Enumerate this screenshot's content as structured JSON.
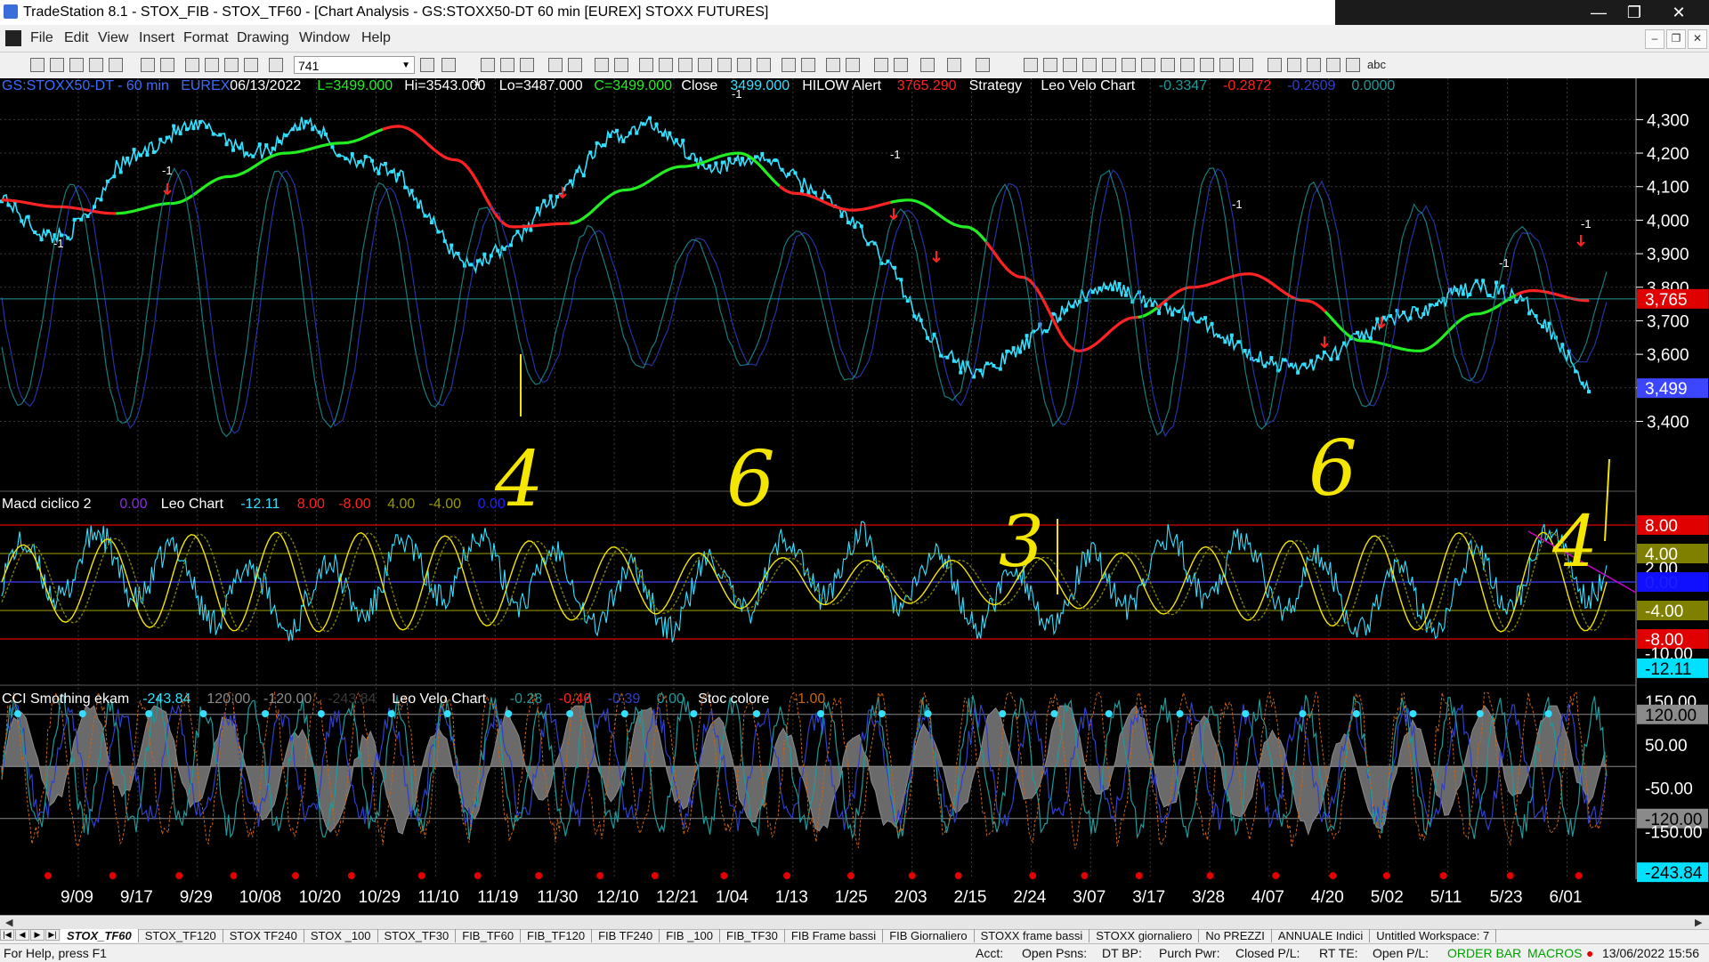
{
  "window": {
    "title": "TradeStation 8.1 - STOX_FIB - STOX_TF60 - [Chart Analysis - GS:STOXX50-DT  60 min  [EUREX] STOXX FUTURES]",
    "minimize": "—",
    "maximize": "❐",
    "close": "✕"
  },
  "menu": {
    "items": [
      "File",
      "Edit",
      "View",
      "Insert",
      "Format",
      "Drawing",
      "Window",
      "Help"
    ],
    "mdi_min": "–",
    "mdi_restore": "❐",
    "mdi_close": "✕"
  },
  "toolbar": {
    "interval_value": "741",
    "text_tool": "abc"
  },
  "colors": {
    "background": "#000000",
    "price": "#33e0ff",
    "ma_up": "#22ee22",
    "ma_down": "#ff2222",
    "osc_blue": "#3040c8",
    "osc_teal": "#1e9a9a",
    "annotation": "#f5e600",
    "histogram": "#6a6a6a"
  },
  "price_panel": {
    "legend": [
      {
        "text": "GS:STOXX50-DT - 60 min",
        "color": "#3c6cff"
      },
      {
        "text": "EUREX",
        "color": "#3c6cff"
      },
      {
        "text": "06/13/2022",
        "color": "#ffffff"
      },
      {
        "text": "L=3499.000",
        "color": "#22ee22"
      },
      {
        "text": "Hi=3543.000",
        "color": "#ffffff"
      },
      {
        "text": "Lo=3487.000",
        "color": "#ffffff"
      },
      {
        "text": "C=3499.000",
        "color": "#22ee22"
      },
      {
        "text": "Close",
        "color": "#ffffff"
      },
      {
        "text": "3499.000",
        "color": "#33e0ff"
      },
      {
        "text": "HILOW Alert",
        "color": "#ffffff"
      },
      {
        "text": "3765.290",
        "color": "#ff2222"
      },
      {
        "text": "Strategy",
        "color": "#ffffff"
      },
      {
        "text": "Leo Velo Chart",
        "color": "#ffffff"
      },
      {
        "text": "-0.3347",
        "color": "#1e9a9a"
      },
      {
        "text": "-0.2872",
        "color": "#ff2222"
      },
      {
        "text": "-0.2609",
        "color": "#3040c8"
      },
      {
        "text": "0.0000",
        "color": "#1e9a9a"
      }
    ],
    "axis_ticks": [
      "4,300",
      "4,200",
      "4,100",
      "4,000",
      "3,900",
      "3,800",
      "3,700",
      "3,600",
      "3,500",
      "3,400"
    ],
    "tag_hilow": "3,765",
    "tag_close": "3,499",
    "ma_path_label": "-1",
    "annotations": [
      "4",
      "6",
      "3",
      "6",
      "4"
    ]
  },
  "macd_panel": {
    "legend": [
      {
        "text": "Macd ciclico 2",
        "color": "#ffffff"
      },
      {
        "text": "0.00",
        "color": "#8a2be2"
      },
      {
        "text": "Leo Chart",
        "color": "#ffffff"
      },
      {
        "text": "-12.11",
        "color": "#33e0ff"
      },
      {
        "text": "8.00",
        "color": "#ff2222"
      },
      {
        "text": "-8.00",
        "color": "#ff2222"
      },
      {
        "text": "4.00",
        "color": "#9a9a00"
      },
      {
        "text": "-4.00",
        "color": "#9a9a00"
      },
      {
        "text": "0.00",
        "color": "#2020ff"
      }
    ],
    "tags": [
      {
        "text": "8.00",
        "bg": "#e00000",
        "fg": "#ffffff"
      },
      {
        "text": "4.00",
        "bg": "#808000",
        "fg": "#ffffff"
      },
      {
        "text": "2.00",
        "bg": "none",
        "fg": "#ffffff"
      },
      {
        "text": "0.00",
        "bg": "#1010ff",
        "fg": "#2020ff"
      },
      {
        "text": "-4.00",
        "bg": "#808000",
        "fg": "#ffffff"
      },
      {
        "text": "-8.00",
        "bg": "#e00000",
        "fg": "#ffffff"
      },
      {
        "text": "-10.00",
        "bg": "none",
        "fg": "#ffffff"
      },
      {
        "text": "-12.11",
        "bg": "#00e0ff",
        "fg": "#000000"
      }
    ]
  },
  "cci_panel": {
    "legend": [
      {
        "text": "CCI Smothing ekam",
        "color": "#ffffff"
      },
      {
        "text": "-243.84",
        "color": "#33e0ff"
      },
      {
        "text": "120.00",
        "color": "#8a8a8a"
      },
      {
        "text": "-120.00",
        "color": "#8a8a8a"
      },
      {
        "text": "-243.84",
        "color": "#3a3a3a"
      },
      {
        "text": "Leo Velo Chart",
        "color": "#ffffff"
      },
      {
        "text": "-0.28",
        "color": "#1e9a9a"
      },
      {
        "text": "-0.46",
        "color": "#ff2222"
      },
      {
        "text": "-0.39",
        "color": "#3040c8"
      },
      {
        "text": "0.00",
        "color": "#1e9a9a"
      },
      {
        "text": "Stoc colore",
        "color": "#ffffff"
      },
      {
        "text": "-1.00",
        "color": "#c86414"
      }
    ],
    "tags": [
      {
        "text": "150.00",
        "bg": "none",
        "fg": "#ffffff"
      },
      {
        "text": "120.00",
        "bg": "#8a8a8a",
        "fg": "#000000"
      },
      {
        "text": "50.00",
        "bg": "none",
        "fg": "#ffffff"
      },
      {
        "text": "-50.00",
        "bg": "none",
        "fg": "#ffffff"
      },
      {
        "text": "-120.00",
        "bg": "#8a8a8a",
        "fg": "#000000"
      },
      {
        "text": "-150.00",
        "bg": "none",
        "fg": "#ffffff"
      },
      {
        "text": "-243.84",
        "bg": "#00e0ff",
        "fg": "#000000"
      }
    ]
  },
  "chart_data": {
    "type": "line",
    "x_labels": [
      "9/09",
      "9/17",
      "9/29",
      "10/08",
      "10/20",
      "10/29",
      "11/10",
      "11/19",
      "11/30",
      "12/10",
      "12/21",
      "1/04",
      "1/13",
      "1/25",
      "2/03",
      "2/15",
      "2/24",
      "3/07",
      "3/17",
      "3/28",
      "4/07",
      "4/20",
      "5/02",
      "5/11",
      "5/23",
      "6/01"
    ],
    "price": {
      "ylim": [
        3250,
        4370
      ],
      "close_points": [
        [
          0,
          4080
        ],
        [
          1,
          4000
        ],
        [
          2,
          3950
        ],
        [
          3,
          3960
        ],
        [
          4,
          4030
        ],
        [
          5,
          4150
        ],
        [
          6,
          4190
        ],
        [
          7,
          4230
        ],
        [
          8,
          4270
        ],
        [
          9,
          4280
        ],
        [
          10,
          4250
        ],
        [
          11,
          4200
        ],
        [
          12,
          4210
        ],
        [
          13,
          4280
        ],
        [
          14,
          4290
        ],
        [
          15,
          4200
        ],
        [
          16,
          4180
        ],
        [
          17,
          4150
        ],
        [
          18,
          4120
        ],
        [
          19,
          4020
        ],
        [
          20,
          3920
        ],
        [
          21,
          3860
        ],
        [
          22,
          3900
        ],
        [
          23,
          3940
        ],
        [
          24,
          4020
        ],
        [
          25,
          4080
        ],
        [
          26,
          4150
        ],
        [
          27,
          4240
        ],
        [
          28,
          4260
        ],
        [
          29,
          4290
        ],
        [
          30,
          4250
        ],
        [
          31,
          4180
        ],
        [
          32,
          4160
        ],
        [
          33,
          4170
        ],
        [
          34,
          4190
        ],
        [
          35,
          4150
        ],
        [
          36,
          4100
        ],
        [
          37,
          4060
        ],
        [
          38,
          4000
        ],
        [
          39,
          3920
        ],
        [
          40,
          3840
        ],
        [
          41,
          3700
        ],
        [
          42,
          3620
        ],
        [
          43,
          3560
        ],
        [
          44,
          3550
        ],
        [
          45,
          3590
        ],
        [
          46,
          3640
        ],
        [
          47,
          3700
        ],
        [
          48,
          3760
        ],
        [
          49,
          3790
        ],
        [
          50,
          3800
        ],
        [
          51,
          3760
        ],
        [
          52,
          3740
        ],
        [
          53,
          3720
        ],
        [
          54,
          3680
        ],
        [
          55,
          3640
        ],
        [
          56,
          3600
        ],
        [
          57,
          3570
        ],
        [
          58,
          3560
        ],
        [
          59,
          3580
        ],
        [
          60,
          3620
        ],
        [
          61,
          3660
        ],
        [
          62,
          3700
        ],
        [
          63,
          3720
        ],
        [
          64,
          3740
        ],
        [
          65,
          3780
        ],
        [
          66,
          3800
        ],
        [
          67,
          3790
        ],
        [
          68,
          3760
        ],
        [
          69,
          3700
        ],
        [
          70,
          3600
        ],
        [
          71,
          3499
        ]
      ],
      "ma_points": [
        [
          0,
          4060
        ],
        [
          3,
          4040
        ],
        [
          6,
          4020
        ],
        [
          9,
          4050
        ],
        [
          12,
          4130
        ],
        [
          15,
          4200
        ],
        [
          18,
          4230
        ],
        [
          21,
          4280
        ],
        [
          24,
          4180
        ],
        [
          27,
          3980
        ],
        [
          30,
          3990
        ],
        [
          33,
          4090
        ],
        [
          36,
          4160
        ],
        [
          39,
          4200
        ],
        [
          42,
          4080
        ],
        [
          45,
          4030
        ],
        [
          48,
          4060
        ],
        [
          51,
          3980
        ],
        [
          54,
          3830
        ],
        [
          57,
          3610
        ],
        [
          60,
          3710
        ],
        [
          63,
          3800
        ],
        [
          66,
          3840
        ],
        [
          69,
          3760
        ],
        [
          72,
          3640
        ],
        [
          75,
          3610
        ],
        [
          78,
          3720
        ],
        [
          81,
          3790
        ],
        [
          84,
          3760
        ]
      ],
      "ma_down_segments": [
        [
          0,
          6
        ],
        [
          20,
          30
        ],
        [
          41,
          47
        ],
        [
          52,
          60
        ],
        [
          61,
          70
        ],
        [
          80,
          86
        ]
      ],
      "yellow_vertical": {
        "x_label_index": 8,
        "y_top": 3930,
        "y_bottom": 3540
      },
      "hline": 3765.29
    },
    "macd": {
      "ylim": [
        -14,
        12
      ],
      "hlines": [
        8,
        4,
        0,
        -4,
        -8
      ],
      "series": [
        {
          "name": "Leo Chart",
          "color": "#33e0ff"
        },
        {
          "color": "#f5e600"
        },
        {
          "color": "#808000"
        }
      ]
    },
    "cci": {
      "ylim": [
        -260,
        175
      ],
      "hlines": [
        120,
        0,
        -120
      ],
      "series": [
        {
          "name": "CCI Smothing ekam",
          "color": "#6a6a6a"
        },
        {
          "name": "Leo Velo Chart",
          "color": "#3040c8"
        },
        {
          "name": "Stoc colore",
          "color": "#c86414"
        }
      ]
    }
  },
  "tabs": [
    {
      "label": "STOX_TF60",
      "active": true
    },
    {
      "label": "STOX_TF120"
    },
    {
      "label": "STOX TF240"
    },
    {
      "label": "STOX _100"
    },
    {
      "label": "STOX_TF30"
    },
    {
      "label": "FIB_TF60"
    },
    {
      "label": "FIB_TF120"
    },
    {
      "label": "FIB TF240"
    },
    {
      "label": "FIB _100"
    },
    {
      "label": "FIB_TF30"
    },
    {
      "label": "FIB Frame bassi"
    },
    {
      "label": "FIB Giornaliero"
    },
    {
      "label": "STOXX frame bassi"
    },
    {
      "label": "STOXX giornaliero"
    },
    {
      "label": "No PREZZI"
    },
    {
      "label": "ANNUALE Indici"
    },
    {
      "label": "Untitled Workspace: 7"
    }
  ],
  "tab_nav": [
    "|◀",
    "◀",
    "▶",
    "▶|"
  ],
  "status": {
    "help": "For Help, press F1",
    "acct": "Acct:",
    "open_psns": "Open Psns:",
    "dt_bp": "DT BP:",
    "purch_pwr": "Purch Pwr:",
    "closed_pl": "Closed P/L:",
    "rt_te": "RT TE:",
    "open_pl": "Open P/L:",
    "order_bar": "ORDER BAR",
    "macros": "MACROS",
    "datetime": "13/06/2022 15:56"
  }
}
